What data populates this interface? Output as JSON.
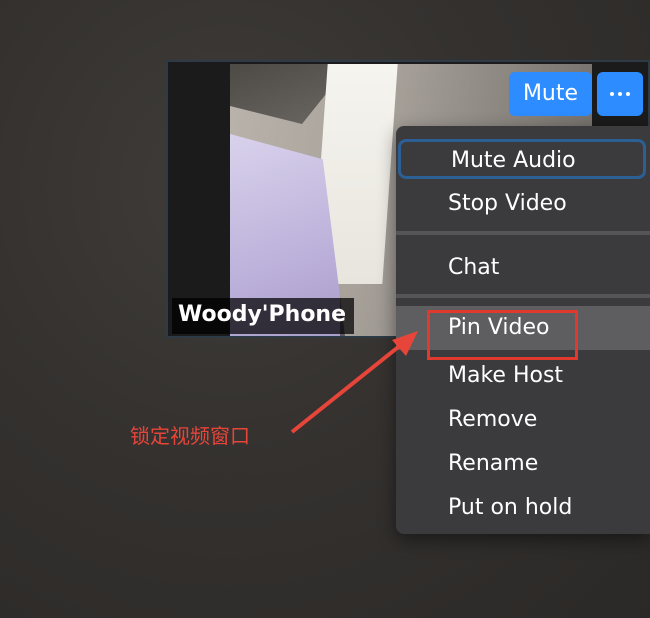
{
  "participant": {
    "name": "Woody'Phone"
  },
  "controls": {
    "mute_label": "Mute",
    "more_icon": "ellipsis-icon"
  },
  "menu": {
    "items": [
      {
        "label": "Mute Audio",
        "state": "focused"
      },
      {
        "label": "Stop Video",
        "state": "normal"
      },
      {
        "label": "Chat",
        "state": "normal"
      },
      {
        "label": "Pin Video",
        "state": "hovered"
      },
      {
        "label": "Make Host",
        "state": "normal"
      },
      {
        "label": "Remove",
        "state": "normal"
      },
      {
        "label": "Rename",
        "state": "normal"
      },
      {
        "label": "Put on hold",
        "state": "normal"
      }
    ]
  },
  "annotation": {
    "text": "锁定视频窗口",
    "color": "#e8453a"
  },
  "colors": {
    "accent": "#2d8cff",
    "menu_bg": "#3b3b3d",
    "highlight": "#e03a2f"
  }
}
